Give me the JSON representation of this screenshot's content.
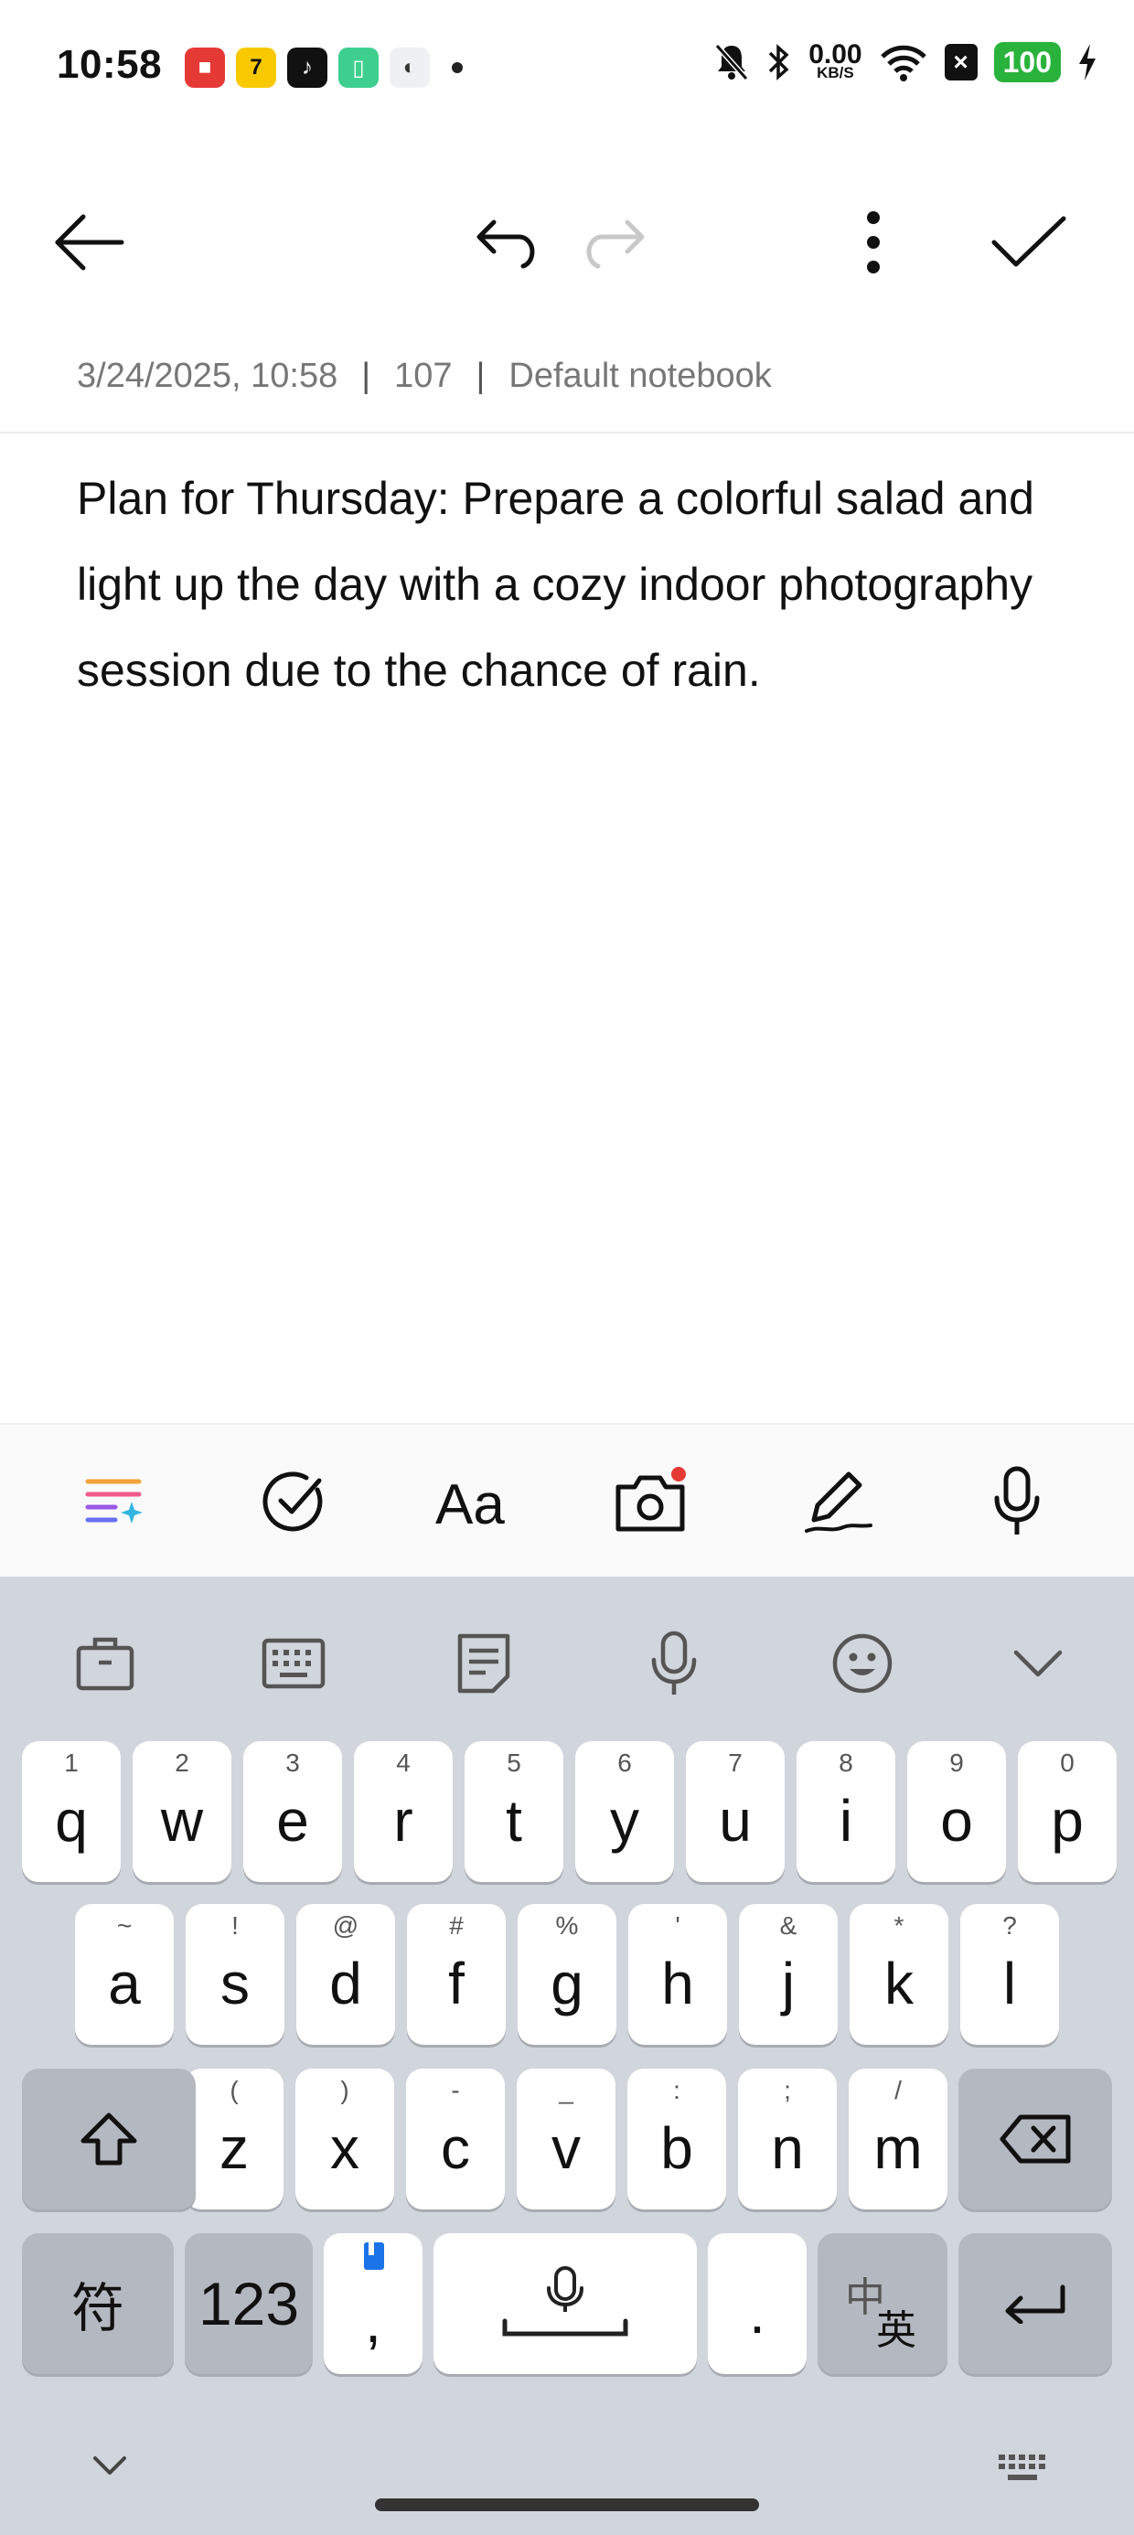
{
  "status_bar": {
    "time": "10:58",
    "net_speed": "0.00",
    "net_unit": "KB/S",
    "battery": "100"
  },
  "note": {
    "date": "3/24/2025, 10:58",
    "char_count": "107",
    "notebook": "Default notebook",
    "body": "Plan for Thursday: Prepare a colorful salad and light up the day with a cozy indoor photography session due to the chance of rain."
  },
  "keyboard": {
    "row1": [
      {
        "k": "q",
        "h": "1"
      },
      {
        "k": "w",
        "h": "2"
      },
      {
        "k": "e",
        "h": "3"
      },
      {
        "k": "r",
        "h": "4"
      },
      {
        "k": "t",
        "h": "5"
      },
      {
        "k": "y",
        "h": "6"
      },
      {
        "k": "u",
        "h": "7"
      },
      {
        "k": "i",
        "h": "8"
      },
      {
        "k": "o",
        "h": "9"
      },
      {
        "k": "p",
        "h": "0"
      }
    ],
    "row2": [
      {
        "k": "a",
        "h": "~"
      },
      {
        "k": "s",
        "h": "!"
      },
      {
        "k": "d",
        "h": "@"
      },
      {
        "k": "f",
        "h": "#"
      },
      {
        "k": "g",
        "h": "%"
      },
      {
        "k": "h",
        "h": "'"
      },
      {
        "k": "j",
        "h": "&"
      },
      {
        "k": "k",
        "h": "*"
      },
      {
        "k": "l",
        "h": "?"
      }
    ],
    "row3": [
      {
        "k": "z",
        "h": "("
      },
      {
        "k": "x",
        "h": ")"
      },
      {
        "k": "c",
        "h": "-"
      },
      {
        "k": "v",
        "h": "_"
      },
      {
        "k": "b",
        "h": ":"
      },
      {
        "k": "n",
        "h": ";"
      },
      {
        "k": "m",
        "h": "/"
      }
    ],
    "symbols_label": "符",
    "numbers_label": "123",
    "comma": ",",
    "period": ".",
    "lang_zh": "中",
    "lang_en": "英"
  }
}
